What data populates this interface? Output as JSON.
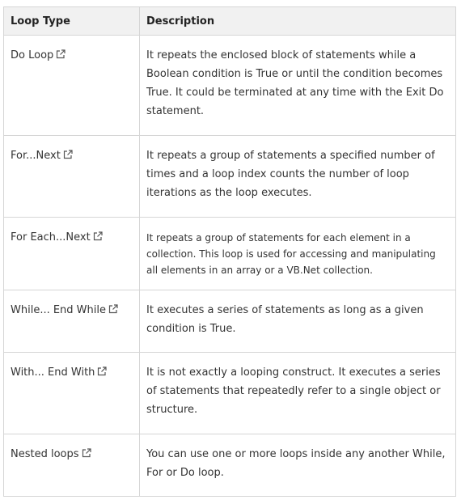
{
  "headers": {
    "type": "Loop Type",
    "description": "Description"
  },
  "icons": {
    "link": "external-link-icon"
  },
  "rows": [
    {
      "name": "Do Loop",
      "description": "It repeats the enclosed block of statements while a Boolean condition is True or until the condition becomes True. It could be terminated at any time with the Exit Do statement."
    },
    {
      "name": "For...Next",
      "description": "It repeats a group of statements a specified number of times and a loop index counts the number of loop iterations as the loop executes."
    },
    {
      "name": "For Each...Next",
      "description": "It repeats a group of statements for each element in a collection. This loop is used for accessing and manipulating all elements in an array or a VB.Net collection."
    },
    {
      "name": "While... End While",
      "description": "It executes a series of statements as long as a given condition is True."
    },
    {
      "name": "With... End With",
      "description": "It is not exactly a looping construct. It executes a series of statements that repeatedly refer to a single object or structure."
    },
    {
      "name": "Nested loops",
      "description": "You can use one or more loops inside any another While, For or Do loop."
    }
  ]
}
